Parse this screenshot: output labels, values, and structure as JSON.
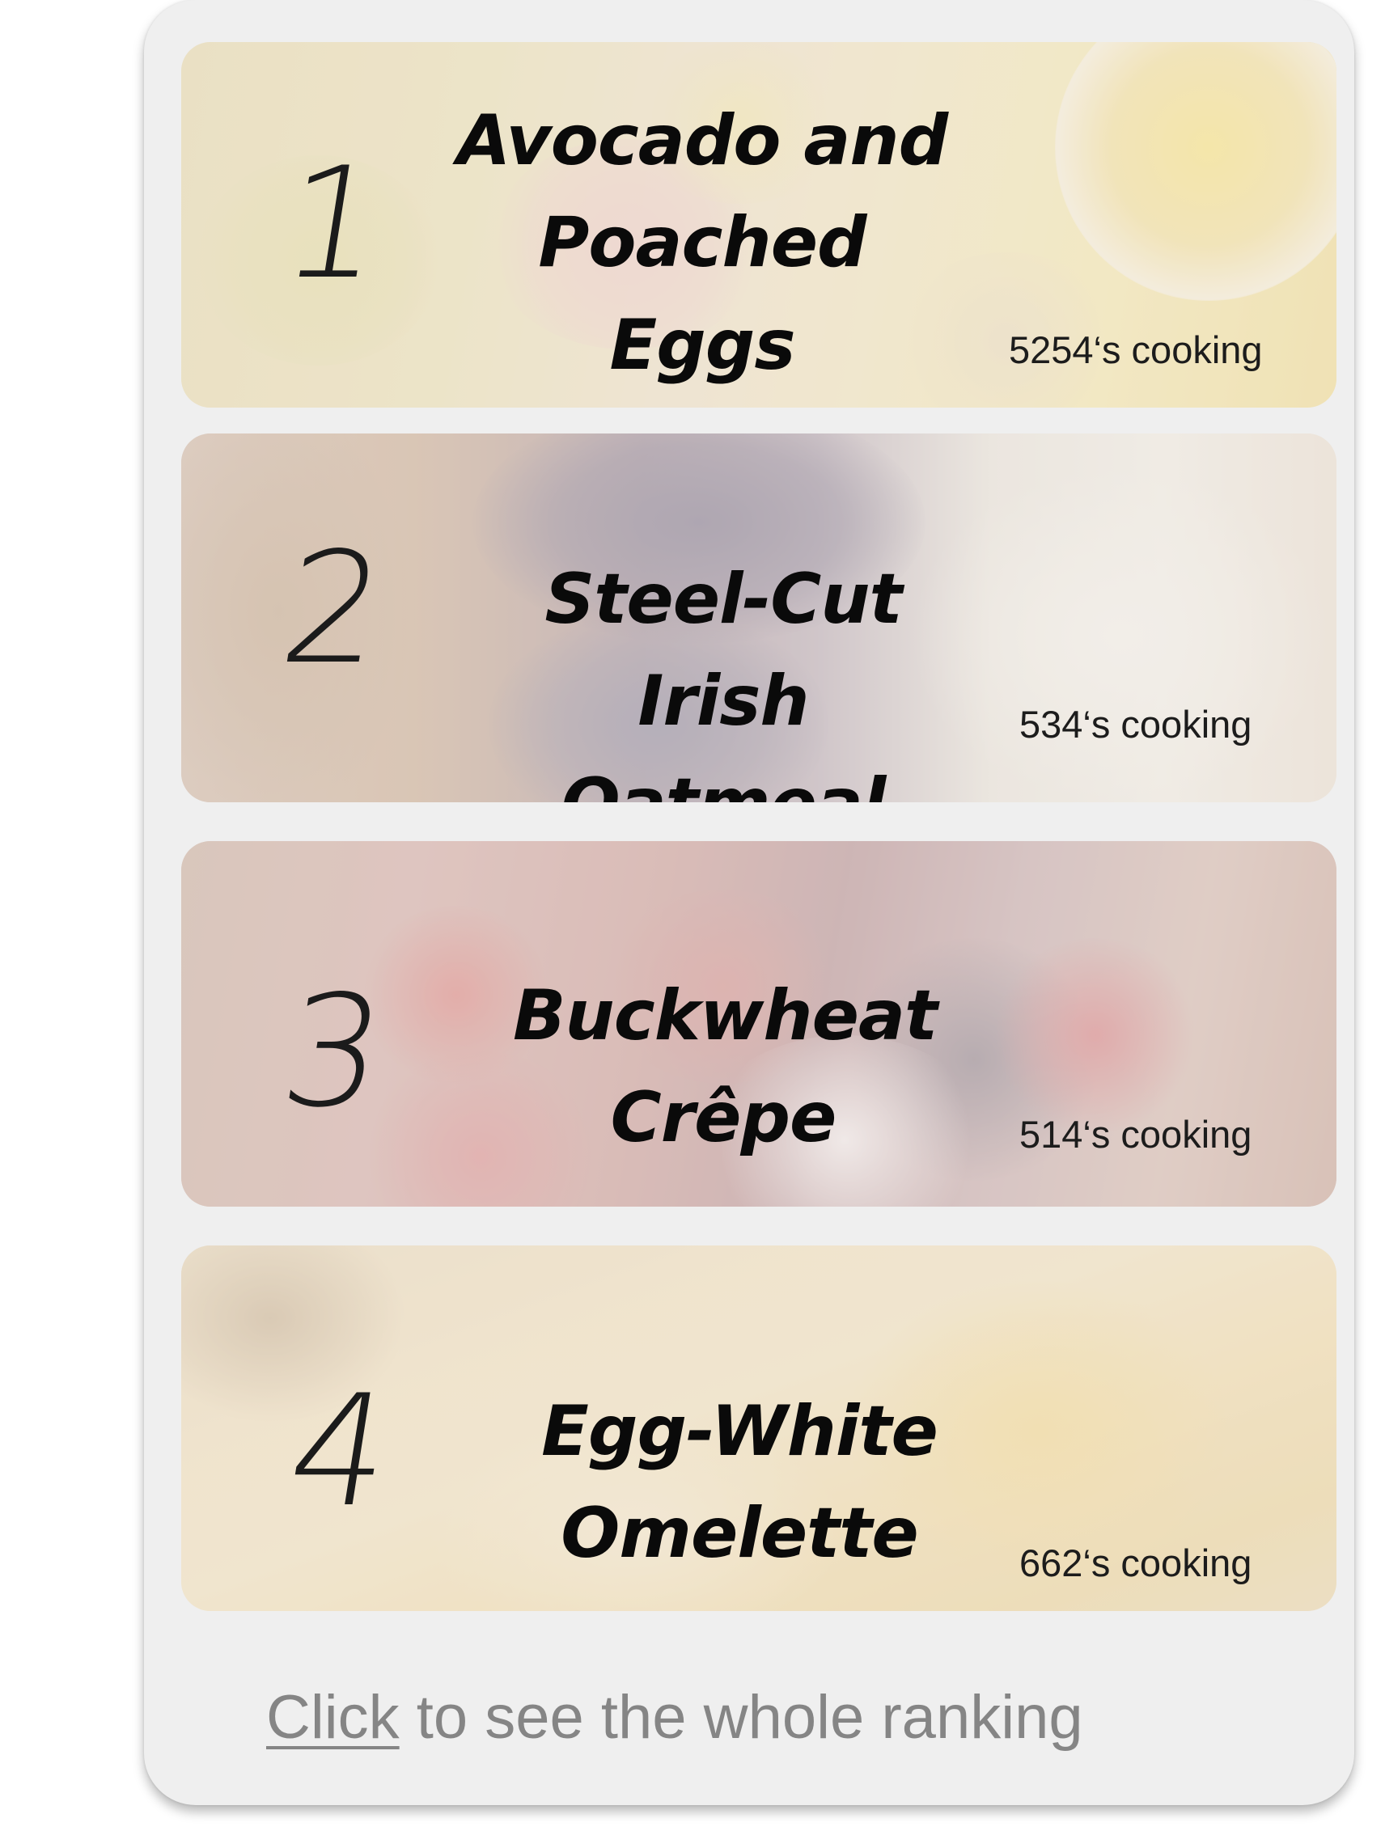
{
  "rankings": [
    {
      "rank": "1",
      "title": "Avocado and\nPoached Eggs\non Toast",
      "cooking": "5254‘s cooking",
      "image": "avocado-toast-photo"
    },
    {
      "rank": "2",
      "title": "Steel-Cut Irish\nOatmeal",
      "cooking": "534‘s cooking",
      "image": "oatmeal-berries-photo"
    },
    {
      "rank": "3",
      "title": "Buckwheat\nCrêpe",
      "cooking": "514‘s cooking",
      "image": "crepe-berries-photo"
    },
    {
      "rank": "4",
      "title": "Egg-White Omelette",
      "cooking": "662‘s cooking",
      "image": "omelette-photo"
    }
  ],
  "footer": {
    "link_text": "Click",
    "rest_text": " to see the whole ranking"
  },
  "colors": {
    "panel_bg": "#efefef",
    "footer_text": "#858585",
    "title_text": "#0a0a0a"
  }
}
